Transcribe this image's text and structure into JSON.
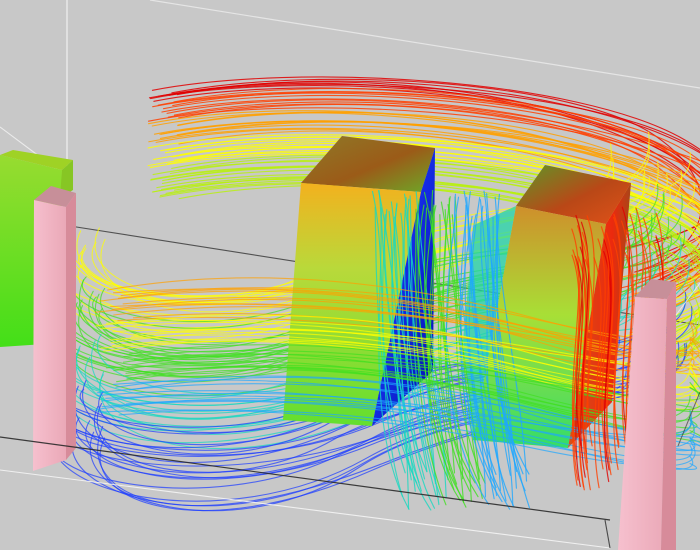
{
  "scene": {
    "background_color": "#c8c8c8",
    "wireframe_color": "#f4f4f4",
    "wireframe_dark_color": "#2a2a2a",
    "pillar_color": "#f2b8c6",
    "pillar_top_color": "#c78f99",
    "colormap": [
      "#1f3fff",
      "#1ea7ff",
      "#18d8c0",
      "#40e020",
      "#b8f010",
      "#ffff00",
      "#ffa000",
      "#ff4000",
      "#e00000"
    ]
  }
}
